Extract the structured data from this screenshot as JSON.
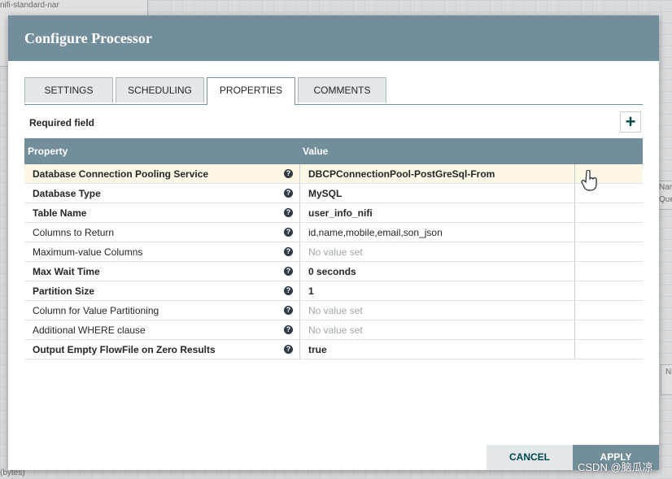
{
  "background": {
    "texts": [
      "nifi-standard-nar",
      "Nar",
      "Que",
      "(bytes)",
      "N"
    ]
  },
  "dialog": {
    "title": "Configure Processor",
    "tabs": [
      {
        "label": "SETTINGS",
        "active": false
      },
      {
        "label": "SCHEDULING",
        "active": false
      },
      {
        "label": "PROPERTIES",
        "active": true
      },
      {
        "label": "COMMENTS",
        "active": false
      }
    ],
    "required_label": "Required field",
    "add_label": "+",
    "columns": {
      "property": "Property",
      "value": "Value"
    },
    "help_glyph": "?",
    "rows": [
      {
        "name": "Database Connection Pooling Service",
        "required": true,
        "value": "DBCPConnectionPool-PostGreSql-From",
        "set": true
      },
      {
        "name": "Database Type",
        "required": true,
        "value": "MySQL",
        "set": true
      },
      {
        "name": "Table Name",
        "required": true,
        "value": "user_info_nifi",
        "set": true
      },
      {
        "name": "Columns to Return",
        "required": false,
        "value": "id,name,mobile,email,son_json",
        "set": true
      },
      {
        "name": "Maximum-value Columns",
        "required": false,
        "value": "No value set",
        "set": false
      },
      {
        "name": "Max Wait Time",
        "required": true,
        "value": "0 seconds",
        "set": true
      },
      {
        "name": "Partition Size",
        "required": true,
        "value": "1",
        "set": true
      },
      {
        "name": "Column for Value Partitioning",
        "required": false,
        "value": "No value set",
        "set": false
      },
      {
        "name": "Additional WHERE clause",
        "required": false,
        "value": "No value set",
        "set": false
      },
      {
        "name": "Output Empty FlowFile on Zero Results",
        "required": true,
        "value": "true",
        "set": true
      }
    ],
    "cancel_label": "CANCEL",
    "apply_label": "APPLY"
  },
  "watermark": "CSDN @脑瓜凉",
  "colors": {
    "header": "#728e9b",
    "selected_row": "#fcf8e5",
    "accent": "#004849"
  }
}
